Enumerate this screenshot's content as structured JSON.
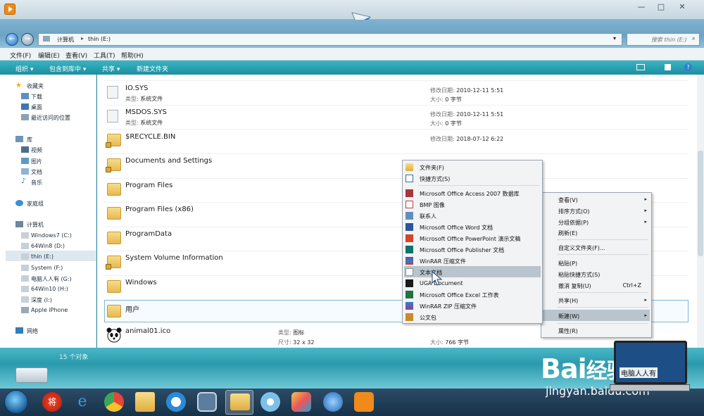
{
  "window": {
    "minimize": "—",
    "maximize": "□",
    "close": "✕"
  },
  "address": {
    "computer": "计算机",
    "drive": "thin (E:)",
    "search_placeholder": "搜索 thin (E:)"
  },
  "menubar": [
    "文件(F)",
    "编辑(E)",
    "查看(V)",
    "工具(T)",
    "帮助(H)"
  ],
  "toolbar": {
    "organize": "组织",
    "include": "包含到库中",
    "share": "共享",
    "new_folder": "新建文件夹"
  },
  "nav": {
    "favorites": "收藏夹",
    "fav_items": [
      "下载",
      "桌面",
      "最近访问的位置"
    ],
    "library": "库",
    "lib_items": [
      "视频",
      "图片",
      "文档",
      "音乐"
    ],
    "homegroup": "家庭组",
    "computer": "计算机",
    "drives": [
      "Windows7 (C:)",
      "64Win8  (D:)",
      "thin (E:)",
      "System (F:)",
      "电脑人人有 (G:)",
      "64Win10 (H:)",
      "深度 (I:)",
      "Apple iPhone"
    ],
    "network": "网络"
  },
  "files": [
    {
      "name": "IO.SYS",
      "type_label": "类型:",
      "type": "系统文件",
      "date_label": "修改日期:",
      "date": "2010-12-11 5:51",
      "size_label": "大小:",
      "size": "0 字节"
    },
    {
      "name": "MSDOS.SYS",
      "type_label": "类型:",
      "type": "系统文件",
      "date_label": "修改日期:",
      "date": "2010-12-11 5:51",
      "size_label": "大小:",
      "size": "0 字节"
    },
    {
      "name": "$RECYCLE.BIN",
      "date_label": "修改日期:",
      "date": "2018-07-12 6:22"
    },
    {
      "name": "Documents and Settings"
    },
    {
      "name": "Program Files"
    },
    {
      "name": "Program Files (x86)"
    },
    {
      "name": "ProgramData"
    },
    {
      "name": "System Volume Information"
    },
    {
      "name": "Windows"
    },
    {
      "name": "用户"
    },
    {
      "name": "animal01.ico",
      "type_label": "类型:",
      "type": "图标",
      "dim_label": "尺寸:",
      "dim": "32 x 32",
      "size_label": "大小:",
      "size": "766 字节"
    }
  ],
  "status": {
    "count": "15 个对象"
  },
  "context_main": [
    {
      "label": "查看(V)",
      "submenu": true
    },
    {
      "label": "排序方式(O)",
      "submenu": true
    },
    {
      "label": "分组依据(P)",
      "submenu": true
    },
    {
      "label": "刷新(E)"
    },
    {
      "label": "自定义文件夹(F)..."
    },
    {
      "label": "粘贴(P)"
    },
    {
      "label": "粘贴快捷方式(S)"
    },
    {
      "label": "撤消 复制(U)",
      "shortcut": "Ctrl+Z"
    },
    {
      "label": "共享(H)",
      "submenu": true
    },
    {
      "label": "新建(W)",
      "submenu": true,
      "highlighted": true
    },
    {
      "label": "属性(R)"
    }
  ],
  "context_new": [
    {
      "label": "文件夹(F)",
      "icon": "folder-icon"
    },
    {
      "label": "快捷方式(S)",
      "icon": "shortcut-icon"
    },
    {
      "label": "Microsoft Office Access 2007 数据库",
      "icon": "access-icon"
    },
    {
      "label": "BMP 图像",
      "icon": "bmp-icon"
    },
    {
      "label": "联系人",
      "icon": "contact-icon"
    },
    {
      "label": "Microsoft Office Word 文档",
      "icon": "word-icon"
    },
    {
      "label": "Microsoft Office PowerPoint 演示文稿",
      "icon": "powerpoint-icon"
    },
    {
      "label": "Microsoft Office Publisher 文档",
      "icon": "publisher-icon"
    },
    {
      "label": "WinRAR 压缩文件",
      "icon": "winrar-icon"
    },
    {
      "label": "文本文档",
      "icon": "text-icon",
      "highlighted": true
    },
    {
      "label": "UGA Document",
      "icon": "uga-icon"
    },
    {
      "label": "Microsoft Office Excel 工作表",
      "icon": "excel-icon"
    },
    {
      "label": "WinRAR ZIP 压缩文件",
      "icon": "zip-icon"
    },
    {
      "label": "公文包",
      "icon": "briefcase-icon"
    }
  ],
  "watermark": {
    "brand": "Bai",
    "brand2": "经验",
    "url": "jingyan.baidu.com",
    "laptop_text": "电脑人人有"
  },
  "colors": {
    "toolbar": "#1b8e9f",
    "status": "#2a9aac",
    "highlight": "#b9c4cc"
  }
}
